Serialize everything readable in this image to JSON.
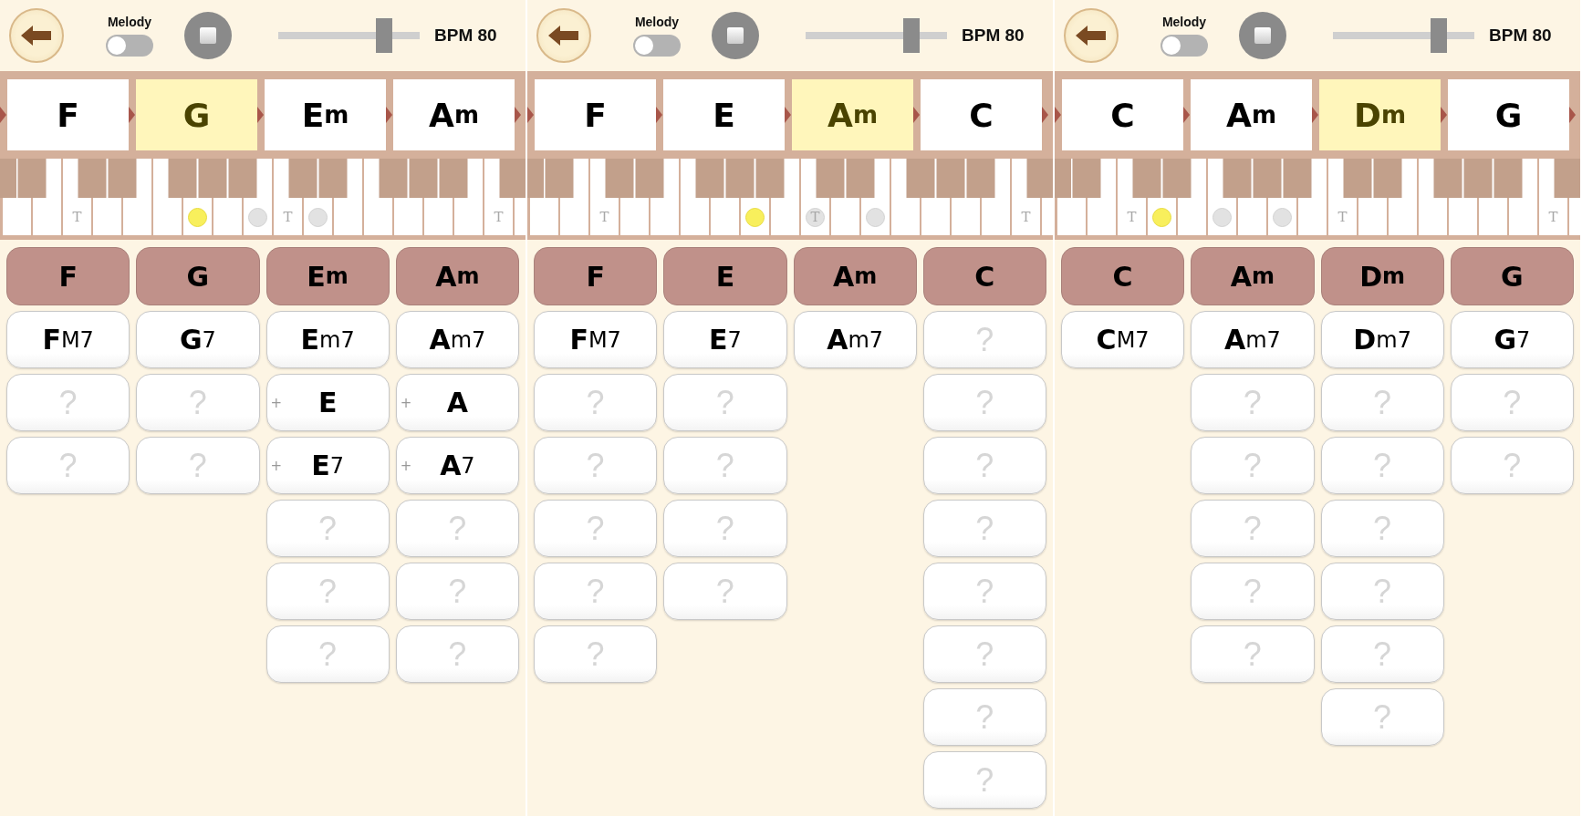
{
  "panels": [
    {
      "toolbar": {
        "melody": {
          "label": "Melody",
          "on": false
        },
        "tempo": {
          "level": 0.75,
          "reading": "BPM 80"
        }
      },
      "progression": [
        {
          "root": "F",
          "selected": false
        },
        {
          "root": "G",
          "selected": true
        },
        {
          "root": "E",
          "suffix": "m",
          "selected": false
        },
        {
          "root": "A",
          "suffix": "m",
          "selected": false
        }
      ],
      "keyboard": [
        {
          "dot": false
        },
        {
          "dot": false
        },
        {
          "dot": false,
          "label": "T"
        },
        {
          "dot": false
        },
        {
          "dot": false
        },
        {
          "dot": false
        },
        {
          "dot": true,
          "root": true
        },
        {
          "dot": false
        },
        {
          "dot": true,
          "root": false
        },
        {
          "dot": false,
          "label": "T"
        },
        {
          "dot": true,
          "root": false
        },
        {
          "dot": false
        },
        {
          "dot": false
        },
        {
          "dot": false
        },
        {
          "dot": false
        },
        {
          "dot": false
        },
        {
          "dot": false,
          "label": "T"
        },
        {
          "dot": false
        }
      ],
      "columns": [
        {
          "header": {
            "root": "F"
          },
          "cells": [
            {
              "kind": "chord",
              "root": "F",
              "suffix": "M7"
            },
            {
              "kind": "empty",
              "label": "?"
            },
            {
              "kind": "empty",
              "label": "?"
            }
          ]
        },
        {
          "header": {
            "root": "G"
          },
          "cells": [
            {
              "kind": "chord",
              "root": "G",
              "suffix": "7"
            },
            {
              "kind": "empty",
              "label": "?"
            },
            {
              "kind": "empty",
              "label": "?"
            }
          ]
        },
        {
          "header": {
            "root": "E",
            "suffix": "m"
          },
          "cells": [
            {
              "kind": "chord",
              "root": "E",
              "suffix": "m7"
            },
            {
              "kind": "chord",
              "root": "E",
              "marker": "+"
            },
            {
              "kind": "chord",
              "root": "E",
              "suffix": "7",
              "marker": "+"
            },
            {
              "kind": "empty",
              "label": "?"
            },
            {
              "kind": "empty",
              "label": "?"
            },
            {
              "kind": "empty",
              "label": "?"
            }
          ]
        },
        {
          "header": {
            "root": "A",
            "suffix": "m"
          },
          "cells": [
            {
              "kind": "chord",
              "root": "A",
              "suffix": "m7"
            },
            {
              "kind": "chord",
              "root": "A",
              "marker": "+"
            },
            {
              "kind": "chord",
              "root": "A",
              "suffix": "7",
              "marker": "+"
            },
            {
              "kind": "empty",
              "label": "?"
            },
            {
              "kind": "empty",
              "label": "?"
            },
            {
              "kind": "empty",
              "label": "?"
            }
          ]
        }
      ]
    },
    {
      "toolbar": {
        "melody": {
          "label": "Melody",
          "on": false
        },
        "tempo": {
          "level": 0.75,
          "reading": "BPM 80"
        }
      },
      "progression": [
        {
          "root": "F",
          "selected": false
        },
        {
          "root": "E",
          "selected": false
        },
        {
          "root": "A",
          "suffix": "m",
          "selected": true
        },
        {
          "root": "C",
          "selected": false
        }
      ],
      "keyboard": [
        {
          "dot": false
        },
        {
          "dot": false
        },
        {
          "dot": false,
          "label": "T"
        },
        {
          "dot": false
        },
        {
          "dot": false
        },
        {
          "dot": false
        },
        {
          "dot": false
        },
        {
          "dot": true,
          "root": true
        },
        {
          "dot": false
        },
        {
          "dot": true,
          "root": false,
          "label": "T"
        },
        {
          "dot": false
        },
        {
          "dot": true,
          "root": false
        },
        {
          "dot": false
        },
        {
          "dot": false
        },
        {
          "dot": false
        },
        {
          "dot": false
        },
        {
          "dot": false,
          "label": "T"
        },
        {
          "dot": false
        }
      ],
      "columns": [
        {
          "header": {
            "root": "F"
          },
          "cells": [
            {
              "kind": "chord",
              "root": "F",
              "suffix": "M7"
            },
            {
              "kind": "empty",
              "label": "?"
            },
            {
              "kind": "empty",
              "label": "?"
            },
            {
              "kind": "empty",
              "label": "?"
            },
            {
              "kind": "empty",
              "label": "?"
            },
            {
              "kind": "empty",
              "label": "?"
            }
          ]
        },
        {
          "header": {
            "root": "E"
          },
          "cells": [
            {
              "kind": "chord",
              "root": "E",
              "suffix": "7"
            },
            {
              "kind": "empty",
              "label": "?"
            },
            {
              "kind": "empty",
              "label": "?"
            },
            {
              "kind": "empty",
              "label": "?"
            },
            {
              "kind": "empty",
              "label": "?"
            }
          ]
        },
        {
          "header": {
            "root": "A",
            "suffix": "m"
          },
          "cells": [
            {
              "kind": "chord",
              "root": "A",
              "suffix": "m7"
            }
          ]
        },
        {
          "header": {
            "root": "C"
          },
          "cells": [
            {
              "kind": "empty",
              "label": "?"
            },
            {
              "kind": "empty",
              "label": "?"
            },
            {
              "kind": "empty",
              "label": "?"
            },
            {
              "kind": "empty",
              "label": "?"
            },
            {
              "kind": "empty",
              "label": "?"
            },
            {
              "kind": "empty",
              "label": "?"
            },
            {
              "kind": "empty",
              "label": "?"
            },
            {
              "kind": "empty",
              "label": "?"
            }
          ]
        }
      ]
    },
    {
      "toolbar": {
        "melody": {
          "label": "Melody",
          "on": false
        },
        "tempo": {
          "level": 0.75,
          "reading": "BPM 80"
        }
      },
      "progression": [
        {
          "root": "C",
          "selected": false
        },
        {
          "root": "A",
          "suffix": "m",
          "selected": false
        },
        {
          "root": "D",
          "suffix": "m",
          "selected": true
        },
        {
          "root": "G",
          "selected": false
        }
      ],
      "keyboard": [
        {
          "dot": false
        },
        {
          "dot": false
        },
        {
          "dot": false,
          "label": "T"
        },
        {
          "dot": true,
          "root": true
        },
        {
          "dot": false
        },
        {
          "dot": true,
          "root": false
        },
        {
          "dot": false
        },
        {
          "dot": true,
          "root": false
        },
        {
          "dot": false
        },
        {
          "dot": false,
          "label": "T"
        },
        {
          "dot": false
        },
        {
          "dot": false
        },
        {
          "dot": false
        },
        {
          "dot": false
        },
        {
          "dot": false
        },
        {
          "dot": false
        },
        {
          "dot": false,
          "label": "T"
        },
        {
          "dot": false
        }
      ],
      "columns": [
        {
          "header": {
            "root": "C"
          },
          "cells": [
            {
              "kind": "chord",
              "root": "C",
              "suffix": "M7"
            }
          ]
        },
        {
          "header": {
            "root": "A",
            "suffix": "m"
          },
          "cells": [
            {
              "kind": "chord",
              "root": "A",
              "suffix": "m7"
            },
            {
              "kind": "empty",
              "label": "?"
            },
            {
              "kind": "empty",
              "label": "?"
            },
            {
              "kind": "empty",
              "label": "?"
            },
            {
              "kind": "empty",
              "label": "?"
            },
            {
              "kind": "empty",
              "label": "?"
            }
          ]
        },
        {
          "header": {
            "root": "D",
            "suffix": "m"
          },
          "cells": [
            {
              "kind": "chord",
              "root": "D",
              "suffix": "m7"
            },
            {
              "kind": "empty",
              "label": "?"
            },
            {
              "kind": "empty",
              "label": "?"
            },
            {
              "kind": "empty",
              "label": "?"
            },
            {
              "kind": "empty",
              "label": "?"
            },
            {
              "kind": "empty",
              "label": "?"
            },
            {
              "kind": "empty",
              "label": "?"
            }
          ]
        },
        {
          "header": {
            "root": "G"
          },
          "cells": [
            {
              "kind": "chord",
              "root": "G",
              "suffix": "7"
            },
            {
              "kind": "empty",
              "label": "?"
            },
            {
              "kind": "empty",
              "label": "?"
            }
          ]
        }
      ]
    }
  ]
}
